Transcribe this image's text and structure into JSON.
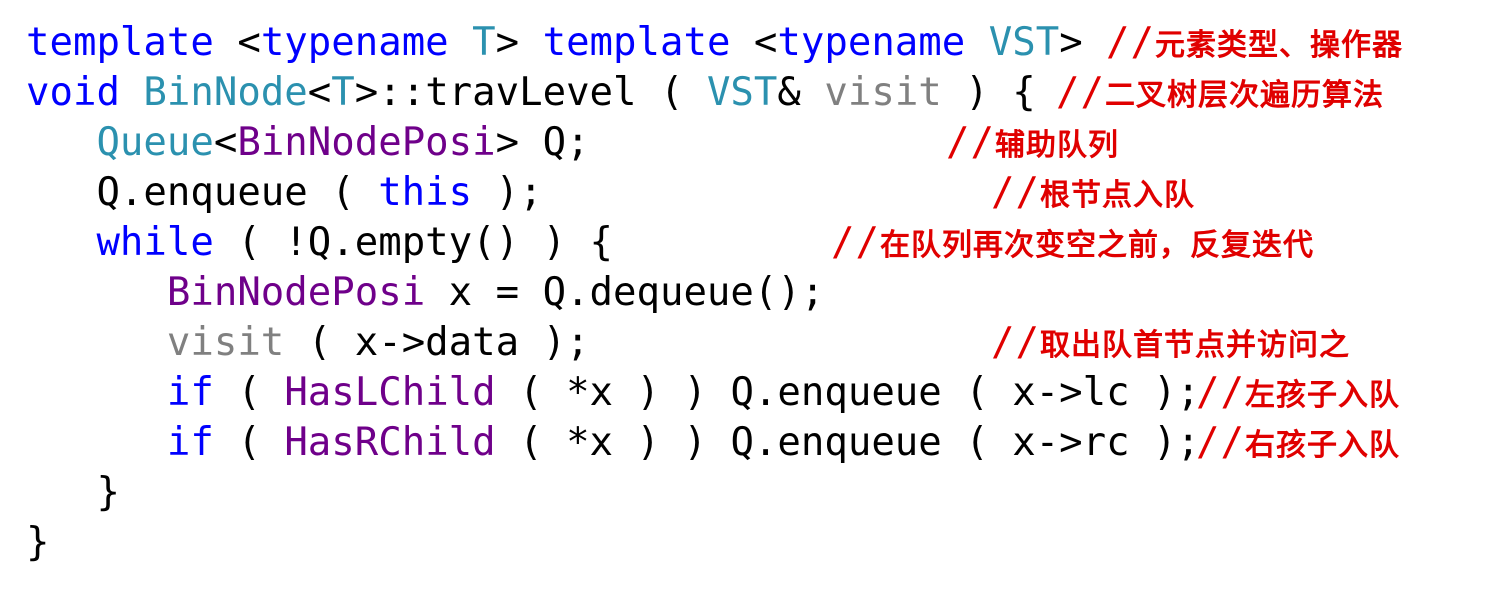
{
  "lines": [
    {
      "tokens": [
        {
          "t": "template",
          "c": "kw"
        },
        {
          "t": " <",
          "c": "tx"
        },
        {
          "t": "typename",
          "c": "kw"
        },
        {
          "t": " ",
          "c": "tx"
        },
        {
          "t": "T",
          "c": "ty"
        },
        {
          "t": "> ",
          "c": "tx"
        },
        {
          "t": "template",
          "c": "kw"
        },
        {
          "t": " <",
          "c": "tx"
        },
        {
          "t": "typename",
          "c": "kw"
        },
        {
          "t": " ",
          "c": "tx"
        },
        {
          "t": "VST",
          "c": "ty"
        },
        {
          "t": ">",
          "c": "tx"
        }
      ],
      "comment": "元素类型、操作器"
    },
    {
      "tokens": [
        {
          "t": "void",
          "c": "kw"
        },
        {
          "t": " ",
          "c": "tx"
        },
        {
          "t": "BinNode",
          "c": "ty"
        },
        {
          "t": "<",
          "c": "tx"
        },
        {
          "t": "T",
          "c": "ty"
        },
        {
          "t": ">::travLevel ( ",
          "c": "tx"
        },
        {
          "t": "VST",
          "c": "ty"
        },
        {
          "t": "& ",
          "c": "tx"
        },
        {
          "t": "visit",
          "c": "par"
        },
        {
          "t": " ) {",
          "c": "tx"
        }
      ],
      "comment": "二叉树层次遍历算法"
    },
    {
      "tokens": [
        {
          "t": "   ",
          "c": "tx"
        },
        {
          "t": "Queue",
          "c": "ty"
        },
        {
          "t": "<",
          "c": "tx"
        },
        {
          "t": "BinNodePosi",
          "c": "mac"
        },
        {
          "t": "> Q;",
          "c": "tx"
        }
      ],
      "comment": "辅助队列"
    },
    {
      "tokens": [
        {
          "t": "   Q.enqueue ( ",
          "c": "tx"
        },
        {
          "t": "this",
          "c": "kw"
        },
        {
          "t": " );",
          "c": "tx"
        }
      ],
      "comment": "根节点入队"
    },
    {
      "tokens": [
        {
          "t": "   ",
          "c": "tx"
        },
        {
          "t": "while",
          "c": "kw"
        },
        {
          "t": " ( !Q.empty() ) {",
          "c": "tx"
        }
      ],
      "comment": "在队列再次变空之前，反复迭代"
    },
    {
      "tokens": [
        {
          "t": "      ",
          "c": "tx"
        },
        {
          "t": "BinNodePosi",
          "c": "mac"
        },
        {
          "t": " x = Q.dequeue();",
          "c": "tx"
        }
      ],
      "comment": ""
    },
    {
      "tokens": [
        {
          "t": "      ",
          "c": "tx"
        },
        {
          "t": "visit",
          "c": "par"
        },
        {
          "t": " ( x->data );",
          "c": "tx"
        }
      ],
      "comment": "取出队首节点并访问之"
    },
    {
      "tokens": [
        {
          "t": "      ",
          "c": "tx"
        },
        {
          "t": "if",
          "c": "kw"
        },
        {
          "t": " ( ",
          "c": "tx"
        },
        {
          "t": "HasLChild",
          "c": "mac"
        },
        {
          "t": " ( *x ) ) Q.enqueue ( x->lc );",
          "c": "tx"
        }
      ],
      "comment": "左孩子入队"
    },
    {
      "tokens": [
        {
          "t": "      ",
          "c": "tx"
        },
        {
          "t": "if",
          "c": "kw"
        },
        {
          "t": " ( ",
          "c": "tx"
        },
        {
          "t": "HasRChild",
          "c": "mac"
        },
        {
          "t": " ( *x ) ) Q.enqueue ( x->rc );",
          "c": "tx"
        }
      ],
      "comment": "右孩子入队"
    },
    {
      "tokens": [
        {
          "t": "   }",
          "c": "tx"
        }
      ],
      "comment": ""
    },
    {
      "tokens": [
        {
          "t": "}",
          "c": "tx"
        }
      ],
      "comment": ""
    }
  ],
  "comment_prefix": "//",
  "colors": {
    "keyword": "#0000ff",
    "type": "#2b91af",
    "macro": "#6f008a",
    "parameter": "#808080",
    "comment": "#e00000",
    "text": "#000000"
  }
}
